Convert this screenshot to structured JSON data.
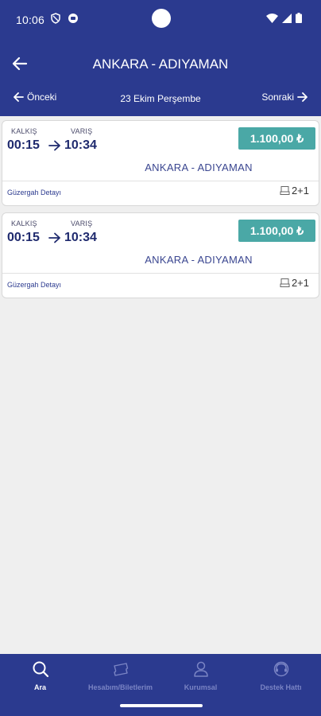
{
  "status_bar": {
    "time": "10:06"
  },
  "header": {
    "title": "ANKARA - ADIYAMAN",
    "prev_label": "Önceki",
    "date": "23 Ekim Perşembe",
    "next_label": "Sonraki"
  },
  "trips": [
    {
      "departure_label": "KALKIŞ",
      "arrival_label": "VARIŞ",
      "departure_time": "00:15",
      "arrival_time": "10:34",
      "price": "1.100,00 ₺",
      "route": "ANKARA - ADIYAMAN",
      "detail_link": "Güzergah Detayı",
      "seat_layout": "2+1"
    },
    {
      "departure_label": "KALKIŞ",
      "arrival_label": "VARIŞ",
      "departure_time": "00:15",
      "arrival_time": "10:34",
      "price": "1.100,00 ₺",
      "route": "ANKARA - ADIYAMAN",
      "detail_link": "Güzergah Detayı",
      "seat_layout": "2+1"
    }
  ],
  "bottom_nav": {
    "items": [
      {
        "label": "Ara",
        "icon": "search-icon",
        "active": true
      },
      {
        "label": "Hesabım/Biletlerim",
        "icon": "ticket-icon",
        "active": false
      },
      {
        "label": "Kurumsal",
        "icon": "user-icon",
        "active": false
      },
      {
        "label": "Destek Hattı",
        "icon": "support-icon",
        "active": false
      }
    ]
  },
  "colors": {
    "primary": "#2b3a8f",
    "price_badge": "#4aa8a6",
    "background": "#efefef",
    "nav_inactive": "#7a84c4"
  }
}
